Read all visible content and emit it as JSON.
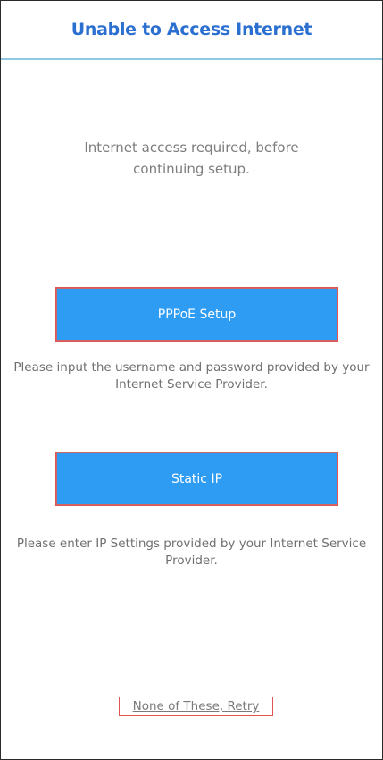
{
  "header": {
    "title": "Unable to Access Internet"
  },
  "intro": {
    "message": "Internet access required, before continuing setup."
  },
  "options": {
    "pppoe": {
      "label": "PPPoE Setup",
      "description": "Please input the username and password provided by your Internet Service Provider."
    },
    "static_ip": {
      "label": "Static IP",
      "description": "Please enter IP Settings provided by your Internet Service Provider."
    }
  },
  "retry": {
    "label": "None of These, Retry"
  },
  "colors": {
    "title": "#2b6fd1",
    "header_divider": "#8fc6e0",
    "button_fill": "#2f9cf3",
    "highlight_outline": "#e25454",
    "body_text": "#707070"
  }
}
